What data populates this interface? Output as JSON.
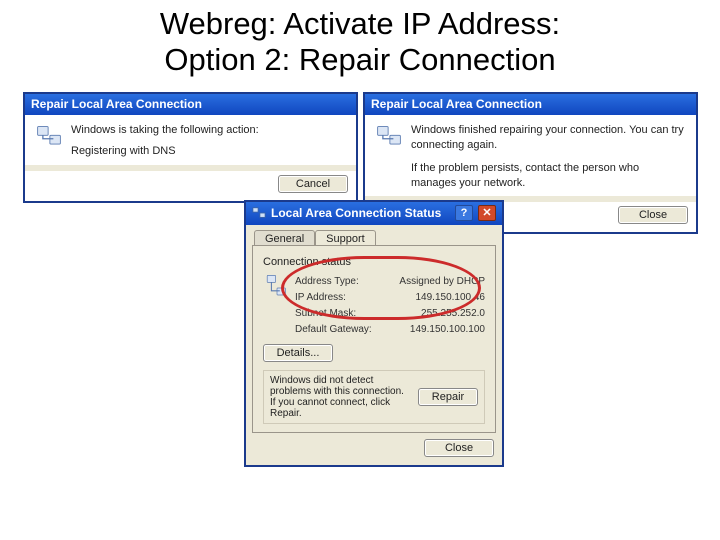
{
  "slide": {
    "title_line1": "Webreg: Activate IP Address:",
    "title_line2": "Option 2: Repair Connection"
  },
  "dialog1": {
    "title": "Repair Local Area Connection",
    "message": "Windows is taking the following action:",
    "step": "Registering with DNS",
    "cancel": "Cancel"
  },
  "dialog2": {
    "title": "Repair Local Area Connection",
    "message1": "Windows finished repairing your connection. You can try connecting again.",
    "message2": "If the problem persists, contact the person who manages your network.",
    "close": "Close"
  },
  "status": {
    "title": "Local Area Connection Status",
    "tab_general": "General",
    "tab_support": "Support",
    "group": "Connection status",
    "rows": {
      "address_type_k": "Address Type:",
      "address_type_v": "Assigned by DHCP",
      "ip_k": "IP Address:",
      "ip_v": "149.150.100.46",
      "mask_k": "Subnet Mask:",
      "mask_v": "255.255.252.0",
      "gw_k": "Default Gateway:",
      "gw_v": "149.150.100.100"
    },
    "details": "Details...",
    "help_text": "Windows did not detect problems with this connection. If you cannot connect, click Repair.",
    "repair": "Repair",
    "close": "Close"
  }
}
